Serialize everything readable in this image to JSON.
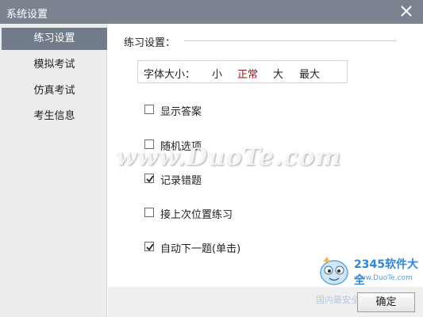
{
  "window": {
    "title": "系统设置"
  },
  "sidebar": {
    "items": [
      {
        "label": "练习设置",
        "active": true
      },
      {
        "label": "模拟考试",
        "active": false
      },
      {
        "label": "仿真考试",
        "active": false
      },
      {
        "label": "考生信息",
        "active": false
      }
    ]
  },
  "settings": {
    "section_title": "练习设置：",
    "font_size": {
      "label": "字体大小：",
      "options": [
        "小",
        "正常",
        "大",
        "最大"
      ],
      "selected": "正常"
    },
    "checkboxes": [
      {
        "label": "显示答案",
        "checked": false
      },
      {
        "label": "随机选项",
        "checked": false
      },
      {
        "label": "记录错题",
        "checked": true
      },
      {
        "label": "接上次位置练习",
        "checked": false
      },
      {
        "label": "自动下一题(单击)",
        "checked": true
      }
    ]
  },
  "footer": {
    "ok_label": "确定"
  },
  "watermarks": {
    "duote": "www.DuoTe.com",
    "brand": "2345软件大全",
    "brand_url": "www.DuoTe.com",
    "tail": "国内最安全的软件站"
  },
  "colors": {
    "titlebar": "#7b8391",
    "sidebar_active": "#727b89",
    "selected_option": "#a01818"
  },
  "icons": {
    "close": "close-icon",
    "check": "checkmark-icon"
  }
}
